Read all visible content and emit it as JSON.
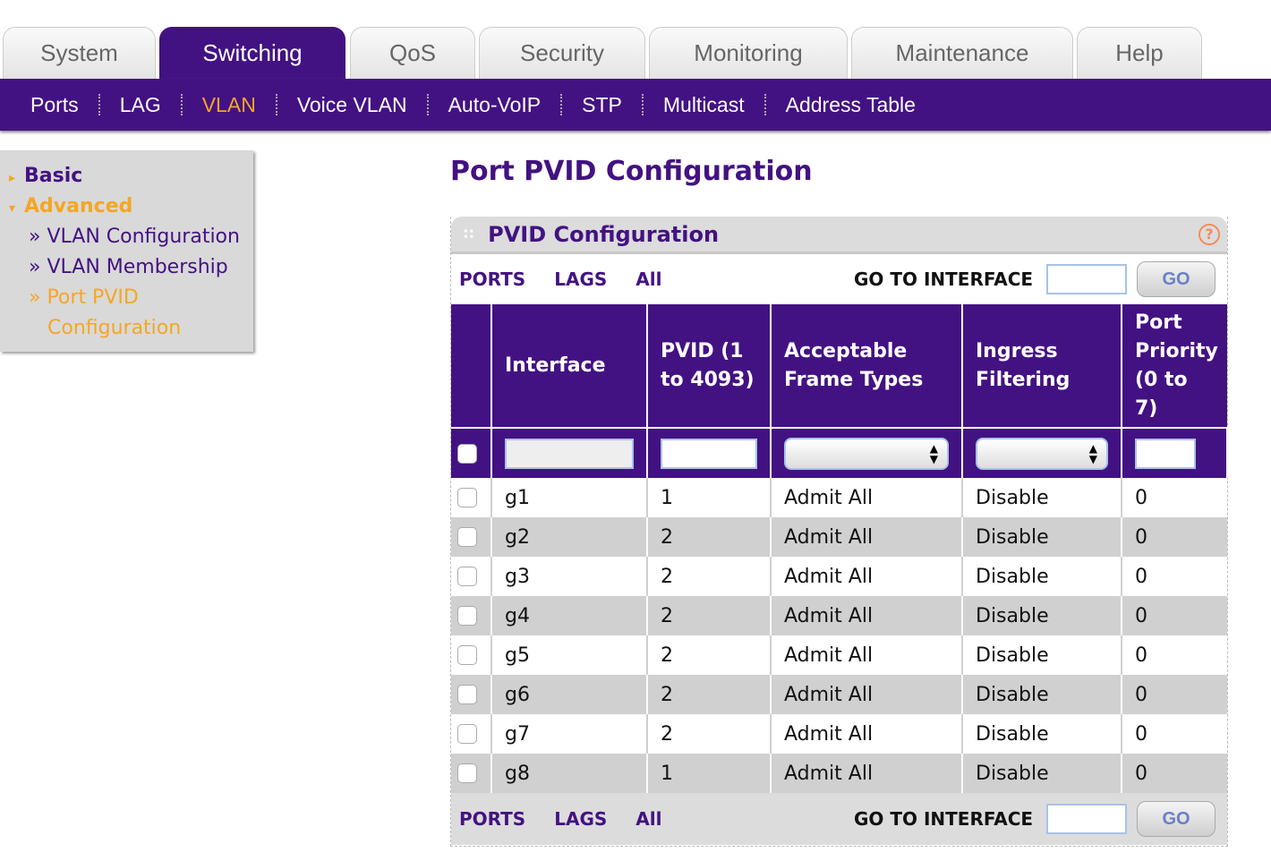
{
  "top_tabs": [
    "System",
    "Switching",
    "QoS",
    "Security",
    "Monitoring",
    "Maintenance",
    "Help"
  ],
  "active_top_tab": "Switching",
  "sub_nav": [
    "Ports",
    "LAG",
    "VLAN",
    "Voice VLAN",
    "Auto-VoIP",
    "STP",
    "Multicast",
    "Address Table"
  ],
  "active_sub_nav": "VLAN",
  "sidebar": {
    "basic": "Basic",
    "advanced": "Advanced",
    "items": [
      "» VLAN Configuration",
      "» VLAN Membership",
      "» Port PVID",
      "Configuration"
    ]
  },
  "page_title": "Port PVID Configuration",
  "panel": {
    "title": "PVID Configuration",
    "help_icon": "?",
    "filters": {
      "ports": "PORTS",
      "lags": "LAGS",
      "all": "All",
      "goto": "GO TO INTERFACE",
      "go": "GO"
    },
    "columns": [
      "Interface",
      "PVID (1 to 4093)",
      "Acceptable Frame Types",
      "Ingress Filtering",
      "Port Priority (0 to 7)"
    ],
    "rows": [
      [
        "g1",
        "1",
        "Admit All",
        "Disable",
        "0"
      ],
      [
        "g2",
        "2",
        "Admit All",
        "Disable",
        "0"
      ],
      [
        "g3",
        "2",
        "Admit All",
        "Disable",
        "0"
      ],
      [
        "g4",
        "2",
        "Admit All",
        "Disable",
        "0"
      ],
      [
        "g5",
        "2",
        "Admit All",
        "Disable",
        "0"
      ],
      [
        "g6",
        "2",
        "Admit All",
        "Disable",
        "0"
      ],
      [
        "g7",
        "2",
        "Admit All",
        "Disable",
        "0"
      ],
      [
        "g8",
        "1",
        "Admit All",
        "Disable",
        "0"
      ]
    ]
  },
  "colors": {
    "brand": "#431282",
    "accent": "#f5a623"
  }
}
